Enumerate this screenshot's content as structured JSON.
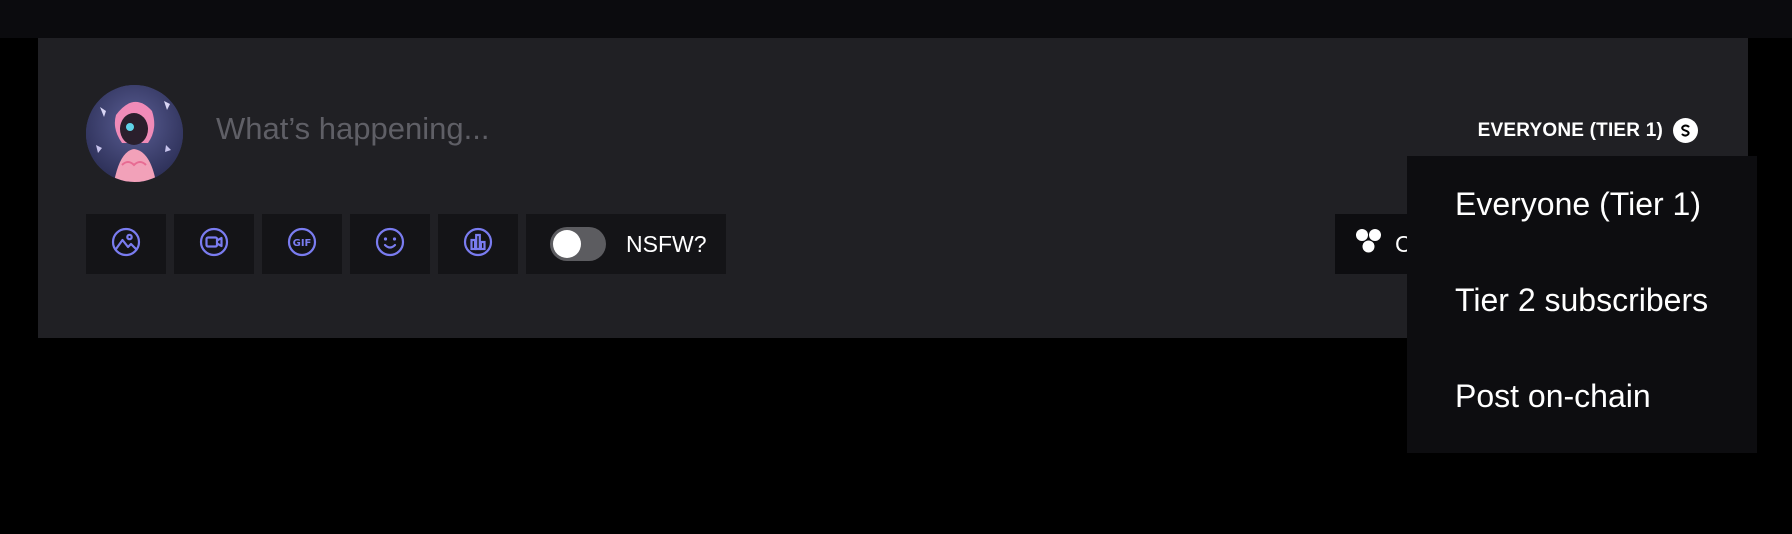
{
  "composer": {
    "placeholder": "What’s happening...",
    "input_value": ""
  },
  "audience": {
    "selected": "EVERYONE (TIER 1)",
    "icon": "coin-icon"
  },
  "toolbar": {
    "buttons": [
      {
        "name": "image-icon"
      },
      {
        "name": "video-icon"
      },
      {
        "name": "gif-icon"
      },
      {
        "name": "emoji-icon"
      },
      {
        "name": "poll-icon"
      }
    ],
    "nsfw_label": "NSFW?",
    "nsfw_enabled": false
  },
  "collection_button": {
    "label": "C",
    "icon": "cluster-icon"
  },
  "dropdown": {
    "options": [
      {
        "label": "Everyone (Tier 1)"
      },
      {
        "label": "Tier 2 subscribers"
      },
      {
        "label": "Post on-chain"
      }
    ]
  },
  "colors": {
    "accent": "#7a7cf0",
    "panel": "#202024",
    "toolbar_button": "#141417",
    "dropdown_bg": "#0d0d10"
  }
}
